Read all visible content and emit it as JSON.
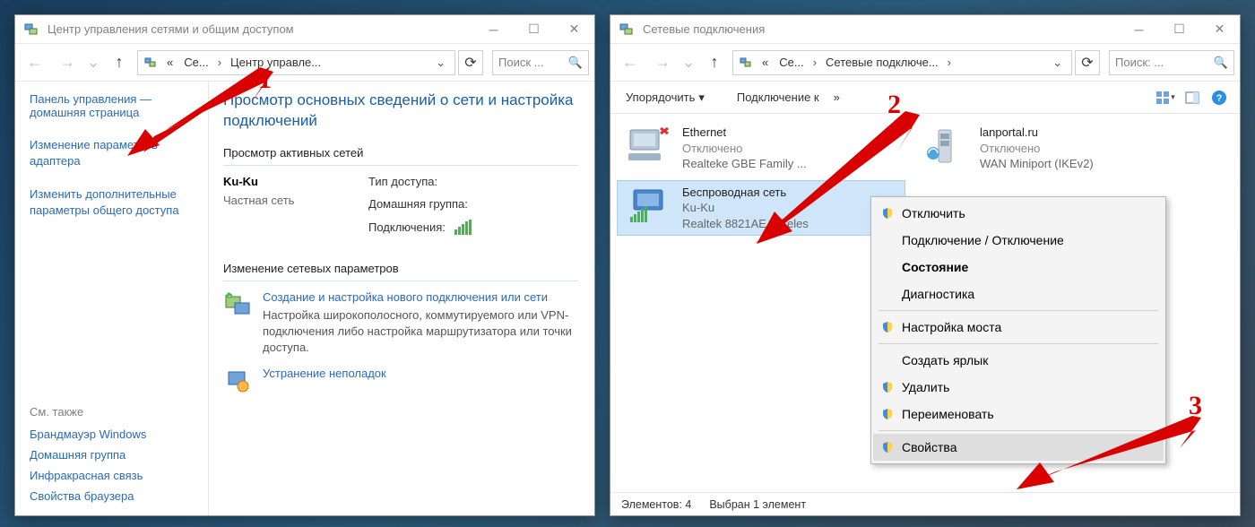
{
  "win1": {
    "title": "Центр управления сетями и общим доступом",
    "address": {
      "crumb0": "«",
      "crumb1": "Се...",
      "crumb2": "Центр управле..."
    },
    "search_placeholder": "Поиск ...",
    "sidebar": {
      "home_line1": "Панель управления —",
      "home_line2": "домашняя страница",
      "link_adapter": "Изменение параметров адаптера",
      "link_sharing": "Изменить дополнительные параметры общего доступа",
      "see_also_heading": "См. также",
      "see_also": [
        "Брандмауэр Windows",
        "Домашняя группа",
        "Инфракрасная связь",
        "Свойства браузера"
      ]
    },
    "main": {
      "big_title": "Просмотр основных сведений о сети и настройка подключений",
      "active_nets_heading": "Просмотр активных сетей",
      "net_name": "Ku-Ku",
      "net_type": "Частная сеть",
      "access_label": "Тип доступа:",
      "homegroup_label": "Домашняя группа:",
      "connections_label": "Подключения:",
      "change_heading": "Изменение сетевых параметров",
      "task1_link": "Создание и настройка нового подключения или сети",
      "task1_desc": "Настройка широкополосного, коммутируемого или VPN-подключения либо настройка маршрутизатора или точки доступа.",
      "task2_link": "Устранение неполадок"
    }
  },
  "win2": {
    "title": "Сетевые подключения",
    "address": {
      "crumb0": "«",
      "crumb1": "Се...",
      "crumb2": "Сетевые подключе..."
    },
    "search_placeholder": "Поиск: ...",
    "toolbar": {
      "organize": "Упорядочить",
      "connect": "Подключение к",
      "more": "»"
    },
    "items": [
      {
        "title": "Ethernet",
        "sub1": "Отключено",
        "sub2": "Realteke GBE Family ..."
      },
      {
        "title": "lanportal.ru",
        "sub1": "Отключено",
        "sub2": "WAN Miniport (IKEv2)"
      },
      {
        "title": "Беспроводная сеть",
        "sub1": "Ku-Ku",
        "sub2": "Realtek 8821AE Wireles"
      }
    ],
    "status": {
      "count": "Элементов: 4",
      "selected": "Выбран 1 элемент"
    },
    "ctx": {
      "disable": "Отключить",
      "connect": "Подключение / Отключение",
      "status": "Состояние",
      "diag": "Диагностика",
      "bridge": "Настройка моста",
      "shortcut": "Создать ярлык",
      "delete": "Удалить",
      "rename": "Переименовать",
      "props": "Свойства"
    }
  },
  "anno": {
    "one": "1",
    "two": "2",
    "three": "3"
  }
}
